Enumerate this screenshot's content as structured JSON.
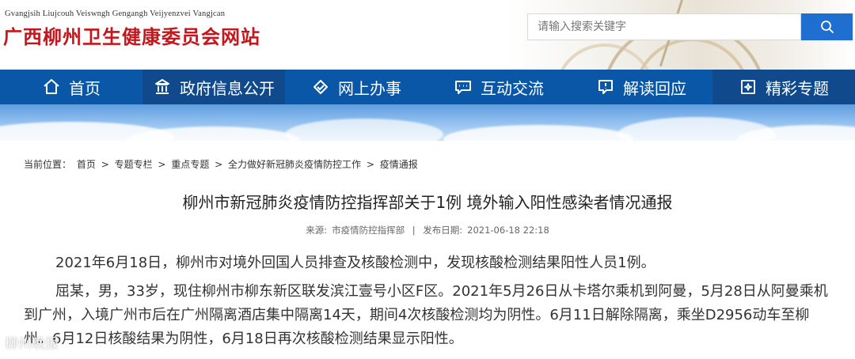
{
  "header": {
    "site_name_en": "Gvangjsih Liujcouh Veiswngh Gengangh Veijyenzvei Vangjcan",
    "site_name_cn": "广西柳州卫生健康委员会网站",
    "search_placeholder": "请输入搜索关键字",
    "search_icon": "search-icon",
    "brand_color": "#c4161c",
    "accent_color": "#1f6fd1"
  },
  "nav": {
    "background": "#0a57a8",
    "items": [
      {
        "label": "首页",
        "icon": "home-icon"
      },
      {
        "label": "政府信息公开",
        "icon": "building-icon"
      },
      {
        "label": "网上办事",
        "icon": "handshake-icon"
      },
      {
        "label": "互动交流",
        "icon": "chat-icon"
      },
      {
        "label": "解读回应",
        "icon": "speech-bubble-icon"
      },
      {
        "label": "精彩专题",
        "icon": "sparkle-icon"
      }
    ]
  },
  "breadcrumb": {
    "prefix": "当前位置：",
    "items": [
      "首页",
      "专题专栏",
      "重点专题",
      "全力做好新冠肺炎疫情防控工作",
      "疫情通报"
    ],
    "separator": ">"
  },
  "article": {
    "title": "柳州市新冠肺炎疫情防控指挥部关于1例 境外输入阳性感染者情况通报",
    "source_label": "来源:",
    "source": "市疫情防控指挥部",
    "divider": "|",
    "date_label": "发布日期:",
    "date": "2021-06-18 22:18",
    "paragraphs": [
      "2021年6月18日，柳州市对境外回国人员排查及核酸检测中，发现核酸检测结果阳性人员1例。",
      "屈某，男，33岁，现住柳州市柳东新区联发滨江壹号小区F区。2021年5月26日从卡塔尔乘机到阿曼，5月28日从阿曼乘机到广州，入境广州市后在广州隔离酒店集中隔离14天，期间4次核酸检测均为阴性。6月11日解除隔离，乘坐D2956动车至柳州。6月12日核酸结果为阴性，6月18日再次核酸检测结果显示阳性。"
    ]
  },
  "watermark": "柳州晚报"
}
